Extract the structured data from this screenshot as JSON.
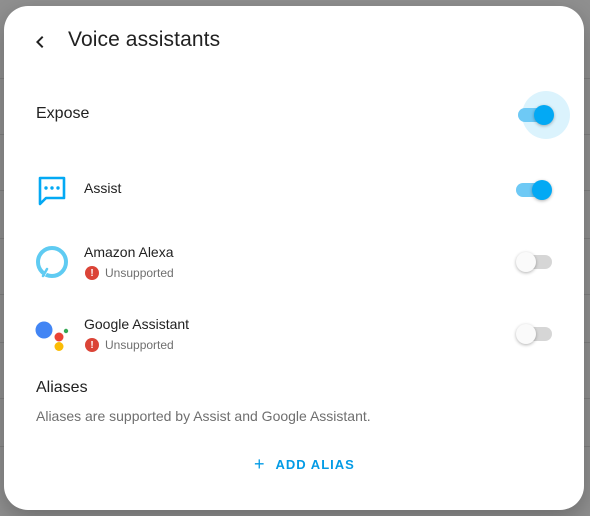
{
  "dialog": {
    "title": "Voice assistants",
    "expose_label": "Expose",
    "expose_on": true
  },
  "assistants": [
    {
      "name": "Assist",
      "icon": "assist-chat-icon",
      "enabled": true,
      "status": ""
    },
    {
      "name": "Amazon Alexa",
      "icon": "amazon-alexa-icon",
      "enabled": false,
      "status": "Unsupported"
    },
    {
      "name": "Google Assistant",
      "icon": "google-assistant-icon",
      "enabled": false,
      "status": "Unsupported"
    }
  ],
  "aliases": {
    "title": "Aliases",
    "description": "Aliases are supported by Assist and Google Assistant.",
    "add_label": "ADD ALIAS"
  },
  "colors": {
    "accent": "#03a9f4",
    "warning": "#db4437"
  }
}
